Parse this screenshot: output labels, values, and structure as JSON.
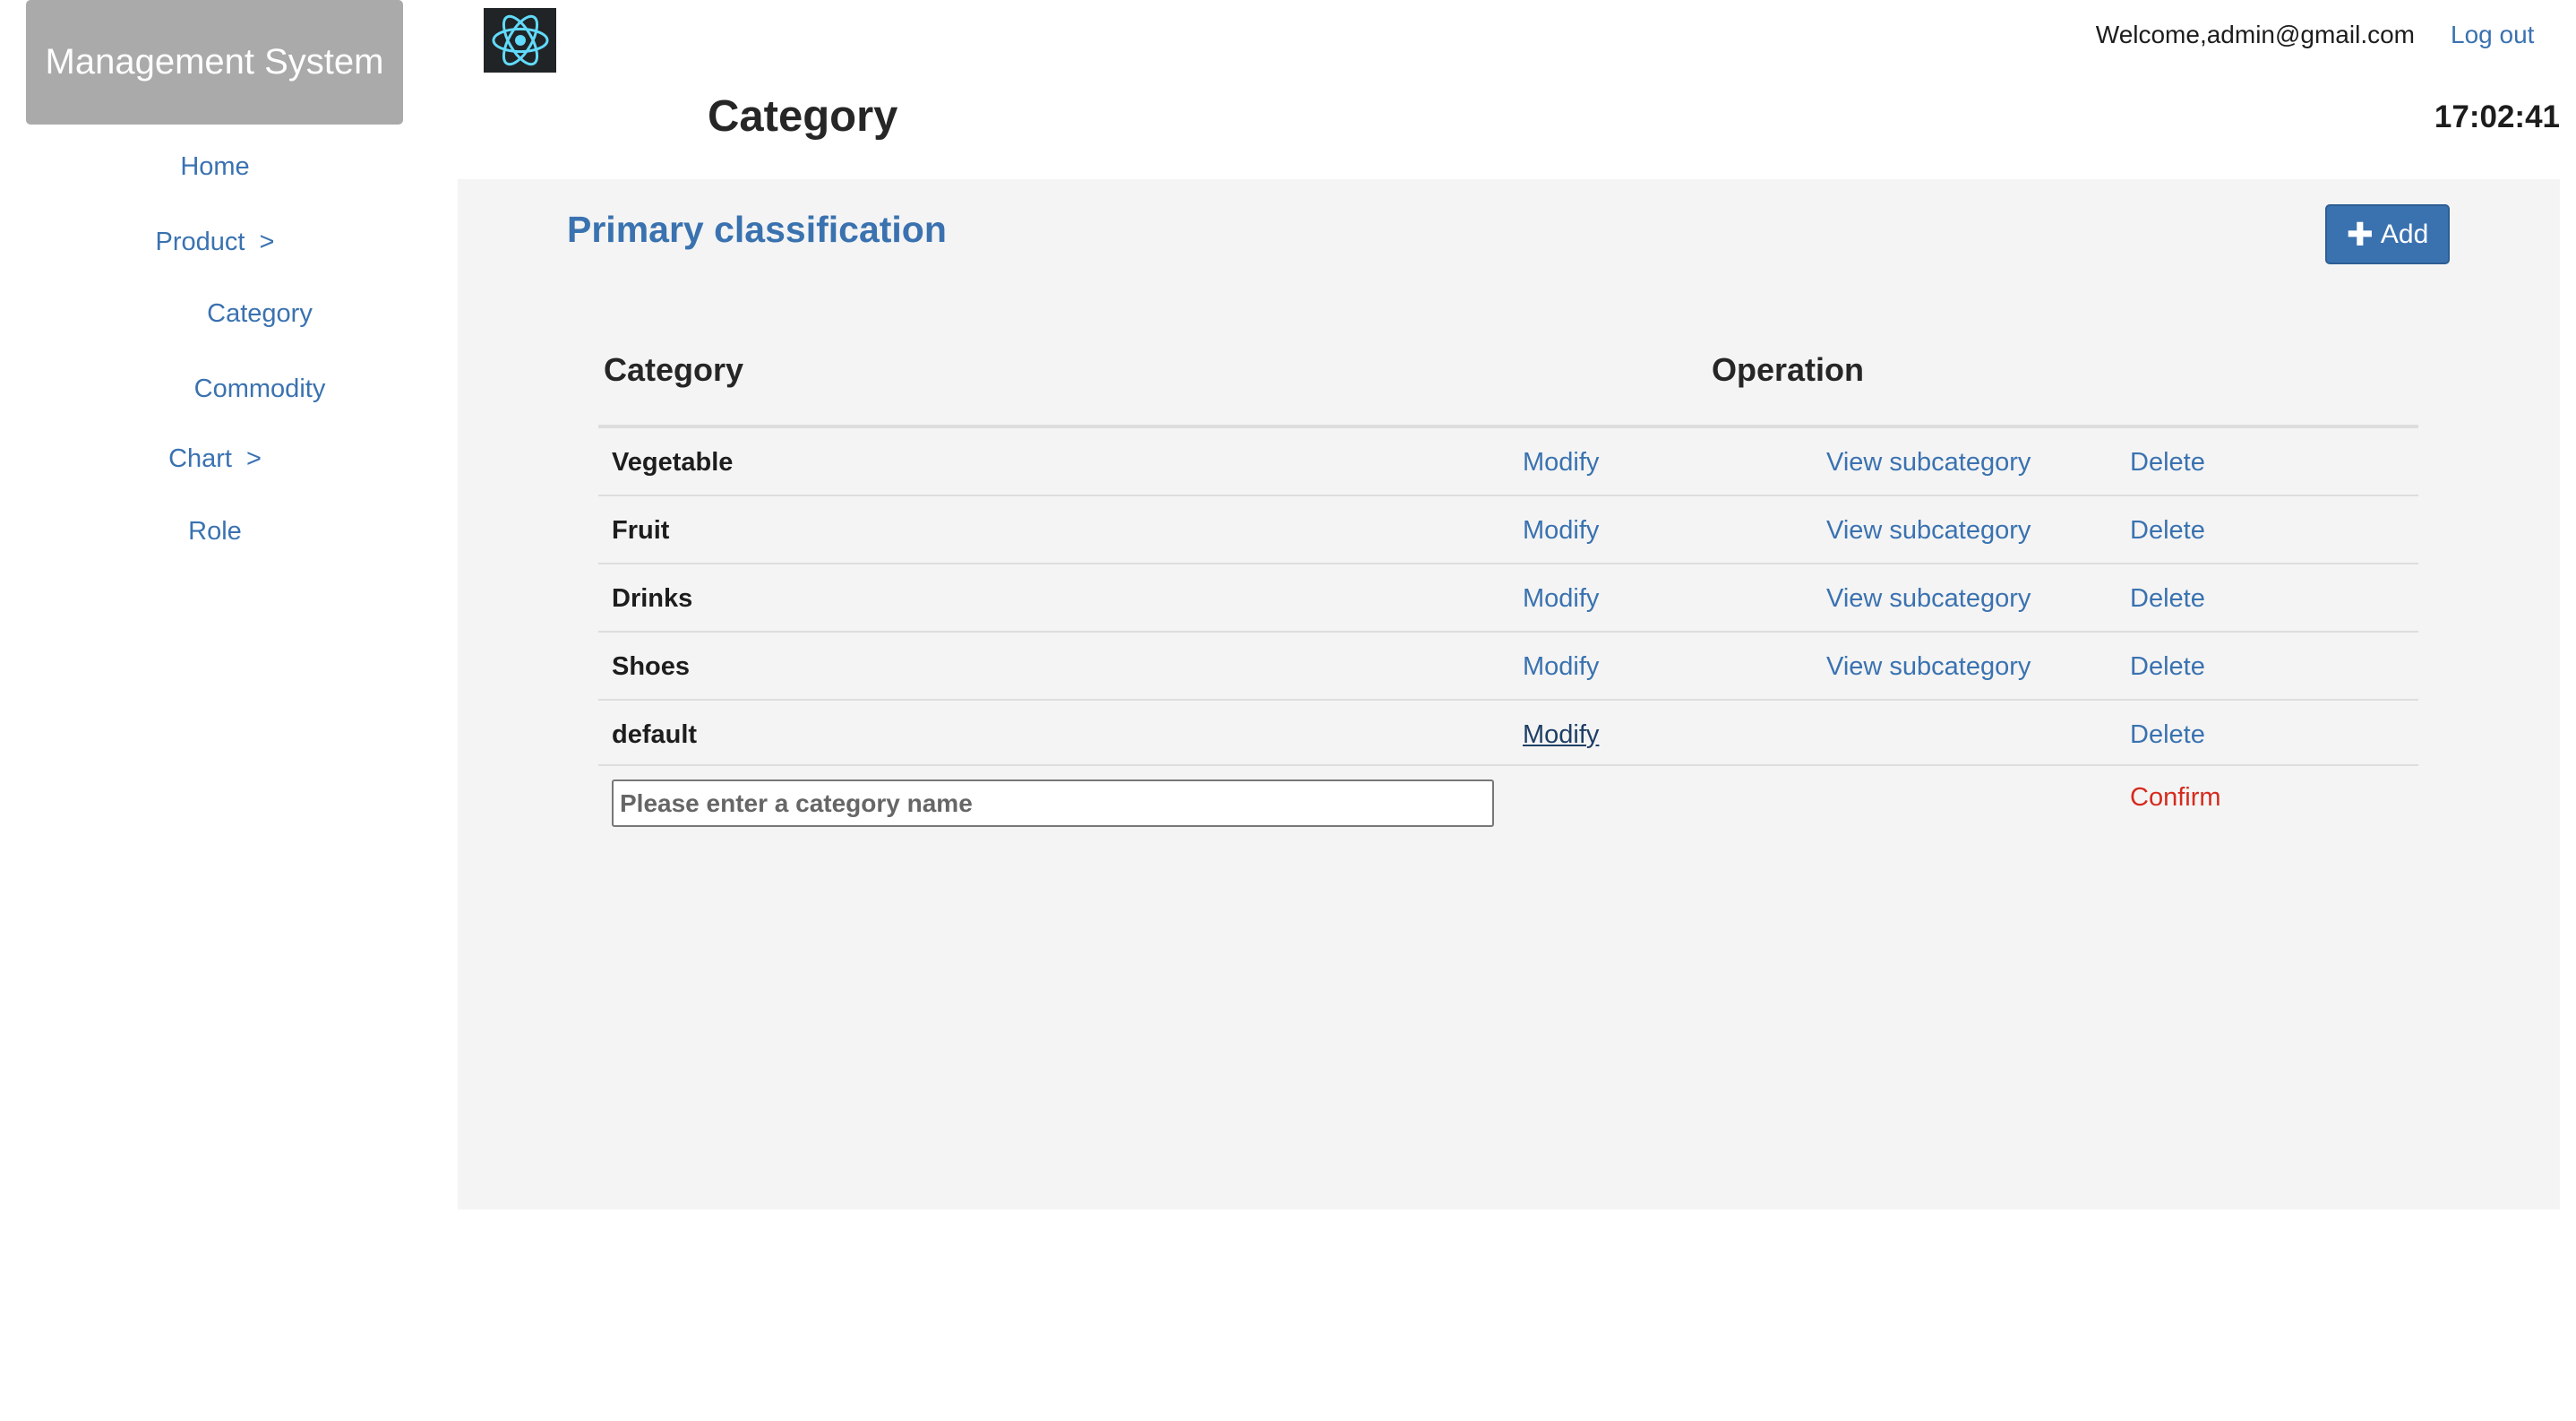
{
  "sidebar": {
    "brand": "Management System",
    "items": [
      {
        "label": "Home",
        "chevron": ""
      },
      {
        "label": "Product",
        "chevron": ">"
      },
      {
        "label": "Category",
        "chevron": ""
      },
      {
        "label": "Commodity",
        "chevron": ""
      },
      {
        "label": "Chart",
        "chevron": ">"
      },
      {
        "label": "Role",
        "chevron": ""
      }
    ]
  },
  "header": {
    "logo_icon": "react-atom-icon",
    "title": "Category",
    "welcome": "Welcome,admin@gmail.com",
    "logout": "Log out",
    "time": "17:02:41"
  },
  "main": {
    "section_title": "Primary classification",
    "add_button": {
      "icon": "plus",
      "label": "Add"
    },
    "columns": {
      "category": "Category",
      "operation": "Operation"
    },
    "rows": [
      {
        "name": "Vegetable",
        "modify": "Modify",
        "view": "View subcategory",
        "delete": "Delete"
      },
      {
        "name": "Fruit",
        "modify": "Modify",
        "view": "View subcategory",
        "delete": "Delete"
      },
      {
        "name": "Drinks",
        "modify": "Modify",
        "view": "View subcategory",
        "delete": "Delete"
      },
      {
        "name": "Shoes",
        "modify": "Modify",
        "view": "View subcategory",
        "delete": "Delete"
      },
      {
        "name": "default",
        "modify": "Modify",
        "view": "",
        "delete": "Delete"
      }
    ],
    "new_category": {
      "placeholder": "Please enter a category name",
      "value": "",
      "confirm": "Confirm"
    }
  },
  "colors": {
    "accent": "#3a72b0",
    "brand_bg": "#aaaaaa",
    "panel_bg": "#f4f4f4",
    "confirm": "#d52b1e",
    "logo_bg": "#202426",
    "logo_fg": "#61dafb"
  }
}
